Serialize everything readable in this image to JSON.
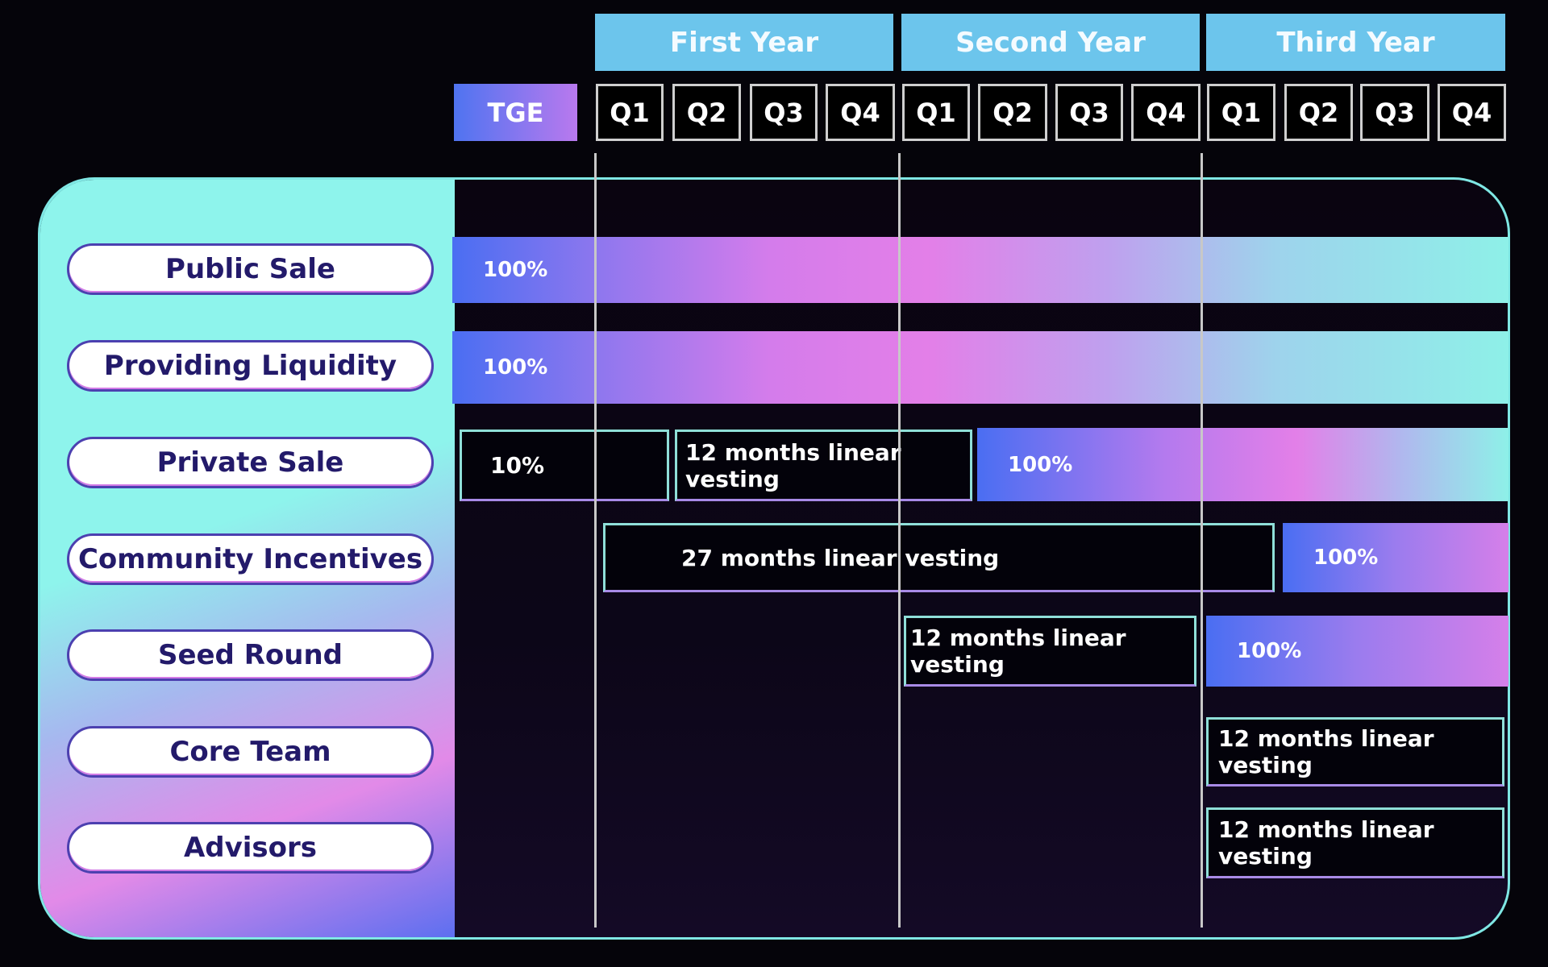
{
  "header": {
    "years": [
      "First Year",
      "Second Year",
      "Third Year"
    ],
    "tge_label": "TGE",
    "quarters": [
      "Q1",
      "Q2",
      "Q3",
      "Q4",
      "Q1",
      "Q2",
      "Q3",
      "Q4",
      "Q1",
      "Q2",
      "Q3",
      "Q4"
    ]
  },
  "rows": [
    {
      "label": "Public Sale",
      "segments": [
        {
          "text": "100%"
        }
      ]
    },
    {
      "label": "Providing Liquidity",
      "segments": [
        {
          "text": "100%"
        }
      ]
    },
    {
      "label": "Private Sale",
      "segments": [
        {
          "text": "10%"
        },
        {
          "text": "12 months linear vesting"
        },
        {
          "text": "100%"
        }
      ]
    },
    {
      "label": "Community Incentives",
      "segments": [
        {
          "text": "27 months linear vesting"
        },
        {
          "text": "100%"
        }
      ]
    },
    {
      "label": "Seed Round",
      "segments": [
        {
          "text": "12 months linear vesting"
        },
        {
          "text": "100%"
        }
      ]
    },
    {
      "label": "Core Team",
      "segments": [
        {
          "text": "12 months linear vesting"
        }
      ]
    },
    {
      "label": "Advisors",
      "segments": [
        {
          "text": "12 months linear vesting"
        }
      ]
    }
  ],
  "colors": {
    "year_header": "#6cc5ec",
    "label_panel": "#8ef4ec",
    "gradient_start": "#4a6ef2",
    "gradient_mid": "#e37fe8",
    "gradient_end": "#8ef0e8",
    "label_text": "#231a6a"
  }
}
